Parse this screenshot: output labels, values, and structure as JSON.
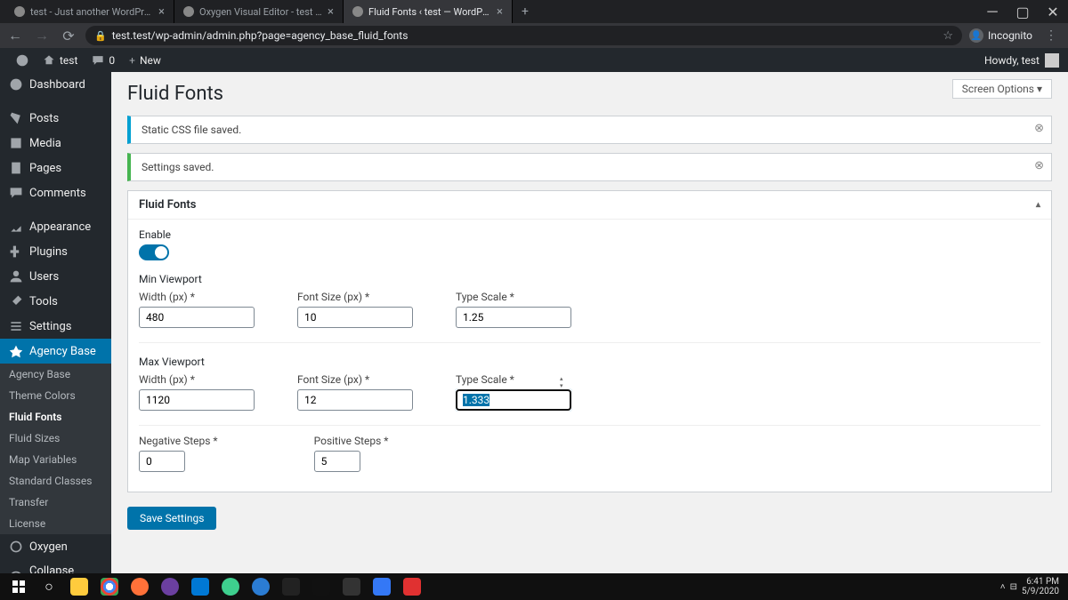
{
  "browser": {
    "tabs": [
      {
        "title": "test - Just another WordPress site"
      },
      {
        "title": "Oxygen Visual Editor - test - Jus"
      },
      {
        "title": "Fluid Fonts ‹ test — WordPress"
      }
    ],
    "url": "test.test/wp-admin/admin.php?page=agency_base_fluid_fonts",
    "incognito": "Incognito"
  },
  "adminbar": {
    "site": "test",
    "comments": "0",
    "new": "New",
    "howdy": "Howdy, test"
  },
  "sidebar": {
    "dashboard": "Dashboard",
    "posts": "Posts",
    "media": "Media",
    "pages": "Pages",
    "comments": "Comments",
    "appearance": "Appearance",
    "plugins": "Plugins",
    "users": "Users",
    "tools": "Tools",
    "settings": "Settings",
    "agency": "Agency Base",
    "sub": {
      "agency": "Agency Base",
      "theme": "Theme Colors",
      "fluidfonts": "Fluid Fonts",
      "fluidsizes": "Fluid Sizes",
      "mapvars": "Map Variables",
      "stdclasses": "Standard Classes",
      "transfer": "Transfer",
      "license": "License"
    },
    "oxygen": "Oxygen",
    "collapse": "Collapse menu"
  },
  "page": {
    "screen_options": "Screen Options ▾",
    "title": "Fluid Fonts",
    "notice1": "Static CSS file saved.",
    "notice2": "Settings saved.",
    "panel_title": "Fluid Fonts",
    "enable": "Enable",
    "min_vp": "Min Viewport",
    "max_vp": "Max Viewport",
    "width_label": "Width (px) *",
    "fontsize_label": "Font Size (px) *",
    "typescale_label": "Type Scale *",
    "neg_steps": "Negative Steps *",
    "pos_steps": "Positive Steps *",
    "values": {
      "min_width": "480",
      "min_fontsize": "10",
      "min_scale": "1.25",
      "max_width": "1120",
      "max_fontsize": "12",
      "max_scale": "1.333",
      "neg": "0",
      "pos": "5"
    },
    "save": "Save Settings"
  },
  "taskbar": {
    "time": "6:41 PM",
    "date": "5/9/2020"
  }
}
